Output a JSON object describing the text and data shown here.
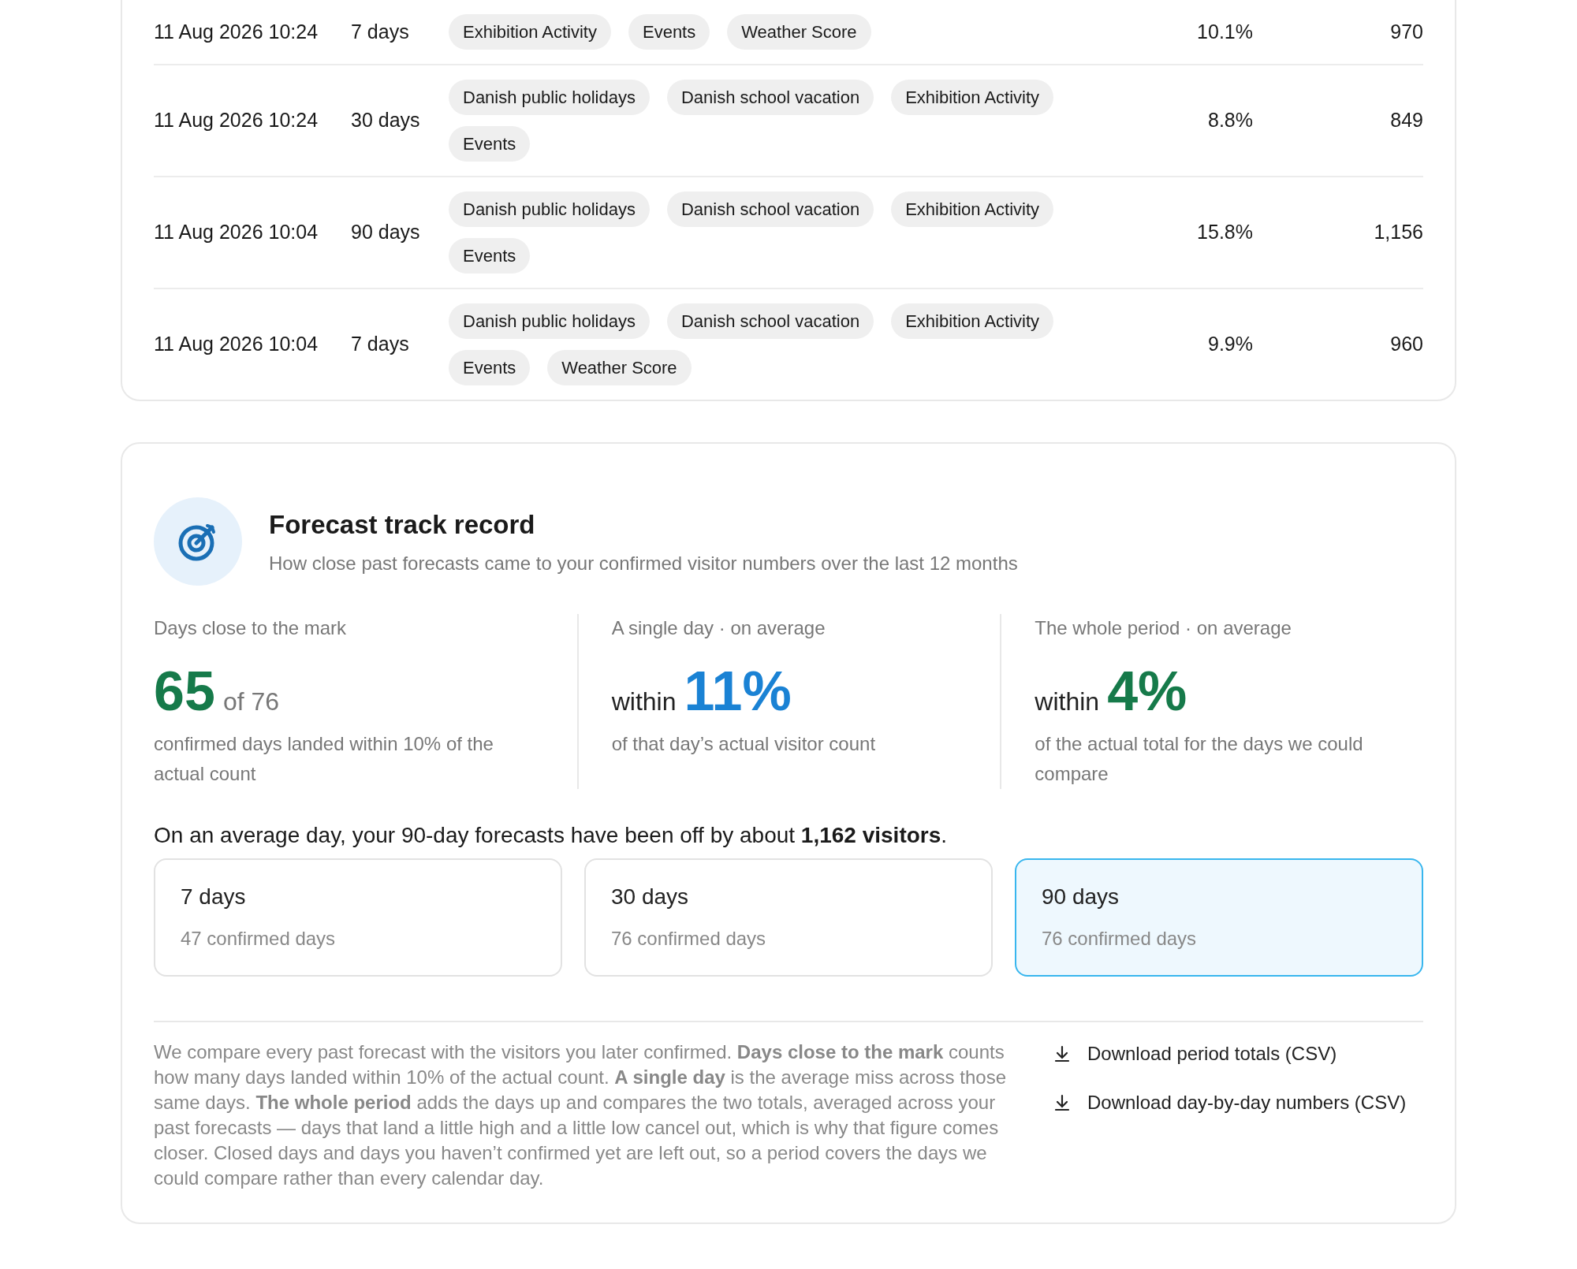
{
  "history_table": {
    "rows": [
      {
        "date": "11 Aug 2026 10:24",
        "horizon": "7 days",
        "tags": [
          "Exhibition Activity",
          "Events",
          "Weather Score"
        ],
        "error": "10.1%",
        "visitors": "970"
      },
      {
        "date": "11 Aug 2026 10:24",
        "horizon": "30 days",
        "tags": [
          "Danish public holidays",
          "Danish school vacation",
          "Exhibition Activity",
          "Events"
        ],
        "error": "8.8%",
        "visitors": "849"
      },
      {
        "date": "11 Aug 2026 10:04",
        "horizon": "90 days",
        "tags": [
          "Danish public holidays",
          "Danish school vacation",
          "Exhibition Activity",
          "Events"
        ],
        "error": "15.8%",
        "visitors": "1,156"
      },
      {
        "date": "11 Aug 2026 10:04",
        "horizon": "7 days",
        "tags": [
          "Danish public holidays",
          "Danish school vacation",
          "Exhibition Activity",
          "Events",
          "Weather Score"
        ],
        "error": "9.9%",
        "visitors": "960"
      }
    ]
  },
  "track_record": {
    "title": "Forecast track record",
    "subtitle": "How close past forecasts came to your confirmed visitor numbers over the last 12 months",
    "stats": [
      {
        "label": "Days close to the mark",
        "value": "65",
        "suffix": "of 76",
        "color": "#167a4a",
        "caption": "confirmed days landed within 10% of the actual count"
      },
      {
        "label": "A single day · on average",
        "prefix": "within",
        "value": "11%",
        "color": "#1a82d4",
        "caption": "of that day’s actual visitor count"
      },
      {
        "label": "The whole period · on average",
        "prefix": "within",
        "value": "4%",
        "color": "#167a4a",
        "caption": "of the actual total for the days we could compare"
      }
    ],
    "summary": "On an average day, your 90-day forecasts have been off by about **1,162 visitors**.",
    "periods": [
      {
        "label": "7 days",
        "detail": "47 confirmed days",
        "selected": false
      },
      {
        "label": "30 days",
        "detail": "76 confirmed days",
        "selected": false
      },
      {
        "label": "90 days",
        "detail": "76 confirmed days",
        "selected": true
      }
    ],
    "explanation": "We compare every past forecast with the visitors you later confirmed. **Days close to the mark** counts how many days landed within 10% of the actual count. **A single day** is the average miss across those same days. **The whole period** adds the days up and compares the two totals, averaged across your past forecasts — days that land a little high and a little low cancel out, which is why that figure comes closer. Closed days and days you haven’t confirmed yet are left out, so a period covers the days we could compare rather than every calendar day.",
    "downloads": [
      "Download period totals (CSV)",
      "Download day-by-day numbers (CSV)"
    ]
  }
}
